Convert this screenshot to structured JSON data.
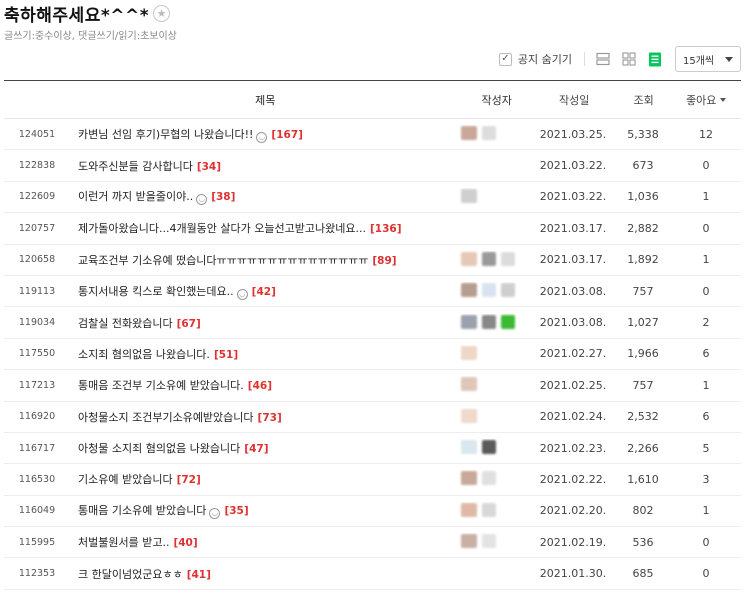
{
  "board": {
    "title": "축하해주세요*^^*",
    "star_glyph": "★",
    "description": "글쓰기:중수이상, 댓글쓰기/읽기:초보이상"
  },
  "toolbar": {
    "hide_notice_label": "공지 숨기기",
    "hide_notice_checked": true,
    "check_glyph": "✓",
    "view_modes": [
      "card-view",
      "album-view",
      "list-view"
    ],
    "active_view": "list-view",
    "per_page_label": "15개씩"
  },
  "columns": {
    "title": "제목",
    "author": "작성자",
    "date": "작성일",
    "views": "조회",
    "likes": "좋아요"
  },
  "colors": {
    "accent_green": "#03c75a",
    "comment_red": "#e03131",
    "header_rule": "#444444"
  },
  "posts": [
    {
      "no": "124051",
      "title": "카변님 선임 후기)무협의 나왔습니다!!",
      "emoji": true,
      "comments": "[167]",
      "date": "2021.03.25.",
      "views": "5,338",
      "likes": "12",
      "author_blur": [
        "#c9a89a",
        "#dddddd"
      ]
    },
    {
      "no": "122838",
      "title": "도와주신분들 감사합니다",
      "emoji": false,
      "comments": "[34]",
      "date": "2021.03.22.",
      "views": "673",
      "likes": "0",
      "author_blur": []
    },
    {
      "no": "122609",
      "title": "이런거 까지 받을줄이야..",
      "emoji": true,
      "comments": "[38]",
      "date": "2021.03.22.",
      "views": "1,036",
      "likes": "1",
      "author_blur": [
        "#cfcfcf"
      ]
    },
    {
      "no": "120757",
      "title": "제가돌아왔습니다...4개월동안 살다가 오늘선고받고나왔네요...",
      "emoji": false,
      "comments": "[136]",
      "date": "2021.03.17.",
      "views": "2,882",
      "likes": "0",
      "author_blur": []
    },
    {
      "no": "120658",
      "title": "교육조건부 기소유예 떴습니다ㅠㅠㅠㅠㅠㅠㅠㅠㅠㅠㅠㅠㅠㅠㅠ",
      "emoji": false,
      "comments": "[89]",
      "date": "2021.03.17.",
      "views": "1,892",
      "likes": "1",
      "author_blur": [
        "#e6c8b5",
        "#9a9a9a",
        "#dcdcdc"
      ]
    },
    {
      "no": "119113",
      "title": "통지서내용 킥스로 확인했는데요..",
      "emoji": true,
      "comments": "[42]",
      "date": "2021.03.08.",
      "views": "757",
      "likes": "0",
      "author_blur": [
        "#b79d8f",
        "#d7e3ee",
        "#cfcfcf"
      ]
    },
    {
      "no": "119034",
      "title": "검찰실 전화왔습니다",
      "emoji": false,
      "comments": "[67]",
      "date": "2021.03.08.",
      "views": "1,027",
      "likes": "2",
      "author_blur": [
        "#9aa3ad",
        "#888888",
        "#3cba34"
      ]
    },
    {
      "no": "117550",
      "title": "소지죄 혐의없음 나왔습니다.",
      "emoji": false,
      "comments": "[51]",
      "date": "2021.02.27.",
      "views": "1,966",
      "likes": "6",
      "author_blur": [
        "#efd7c8"
      ]
    },
    {
      "no": "117213",
      "title": "통매음 조건부 기소유예 받았습니다.",
      "emoji": false,
      "comments": "[46]",
      "date": "2021.02.25.",
      "views": "757",
      "likes": "1",
      "author_blur": [
        "#e0c6b8"
      ]
    },
    {
      "no": "116920",
      "title": "아청물소지 조건부기소유예받았습니다",
      "emoji": false,
      "comments": "[73]",
      "date": "2021.02.24.",
      "views": "2,532",
      "likes": "6",
      "author_blur": [
        "#eed9cc"
      ]
    },
    {
      "no": "116717",
      "title": "아청물 소지죄 혐의없음 나왔습니다",
      "emoji": false,
      "comments": "[47]",
      "date": "2021.02.23.",
      "views": "2,266",
      "likes": "5",
      "author_blur": [
        "#d9e8ef",
        "#5a5a5a"
      ]
    },
    {
      "no": "116530",
      "title": "기소유예 받았습니다",
      "emoji": false,
      "comments": "[72]",
      "date": "2021.02.22.",
      "views": "1,610",
      "likes": "3",
      "author_blur": [
        "#c8a898",
        "#e0e0e0"
      ]
    },
    {
      "no": "116049",
      "title": "통매음 기소유예 받았습니다",
      "emoji": true,
      "comments": "[35]",
      "date": "2021.02.20.",
      "views": "802",
      "likes": "1",
      "author_blur": [
        "#dfb9a5",
        "#d8d8d8"
      ]
    },
    {
      "no": "115995",
      "title": "처벌불원서를 받고..",
      "emoji": false,
      "comments": "[40]",
      "date": "2021.02.19.",
      "views": "536",
      "likes": "0",
      "author_blur": [
        "#c9b0a3",
        "#e3e3e3"
      ]
    },
    {
      "no": "112353",
      "title": "크 한달이넘었군요ㅎㅎ",
      "emoji": false,
      "comments": "[41]",
      "date": "2021.01.30.",
      "views": "685",
      "likes": "0",
      "author_blur": []
    }
  ]
}
